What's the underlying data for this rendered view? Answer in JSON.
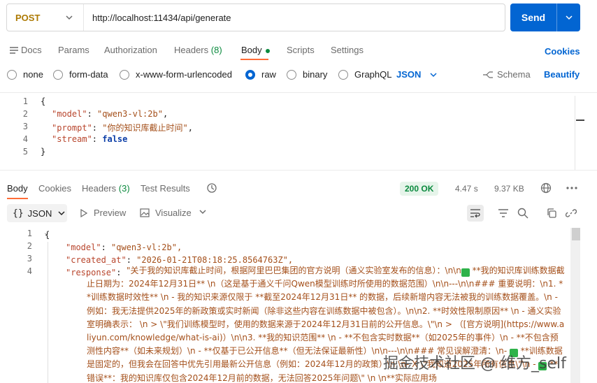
{
  "request": {
    "method": "POST",
    "url": "http://localhost:11434/api/generate",
    "send_label": "Send"
  },
  "request_tabs": {
    "docs": "Docs",
    "params": "Params",
    "authorization": "Authorization",
    "headers": "Headers",
    "headers_count": "(8)",
    "body": "Body",
    "scripts": "Scripts",
    "settings": "Settings",
    "cookies": "Cookies"
  },
  "body_types": {
    "none": "none",
    "form_data": "form-data",
    "urlencoded": "x-www-form-urlencoded",
    "raw": "raw",
    "binary": "binary",
    "graphql": "GraphQL",
    "format": "JSON",
    "schema": "Schema",
    "beautify": "Beautify"
  },
  "request_body": {
    "line_numbers": [
      "1",
      "2",
      "3",
      "4",
      "5"
    ],
    "open_brace": "{",
    "close_brace": "}",
    "model_key": "\"model\"",
    "model_val": "\"qwen3-vl:2b\"",
    "prompt_key": "\"prompt\"",
    "prompt_val": "\"你的知识库截止时间\"",
    "stream_key": "\"stream\"",
    "stream_val": "false"
  },
  "response_tabs": {
    "body": "Body",
    "cookies": "Cookies",
    "headers": "Headers",
    "headers_count": "(3)",
    "test_results": "Test Results",
    "status": "200 OK",
    "time": "4.47 s",
    "size": "9.37 KB"
  },
  "response_toolbar": {
    "format": "JSON",
    "preview": "Preview",
    "visualize": "Visualize"
  },
  "response_body": {
    "line_numbers": [
      "1",
      "2",
      "3",
      "4"
    ],
    "open_brace": "{",
    "model_key": "\"model\"",
    "model_val": "\"qwen3-vl:2b\",",
    "created_key": "\"created_at\"",
    "created_val": "\"2026-01-21T08:18:25.8564763Z\",",
    "response_key": "\"response\"",
    "response_part1": "\"关于我的知识库截止时间，根据阿里巴巴集团的官方说明（通义实验室发布的信息）：\\n\\n",
    "response_part2": " **我的知识库训练数据截止日期为：2024年12月31日**  \\n（这是基于通义千问Qwen模型训练时所使用的数据范围）\\n\\n---\\n\\n### 重要说明：\\n1. **训练数据时效性**  \\n   - 我的知识来源仅限于 **截至2024年12月31日** 的数据，后续新增内容无法被我的训练数据覆盖。\\n   - 例如：我无法提供2025年的新政策或实时新闻（除非这些内容在训练数据中被包含）。\\n\\n2. **时效性限制原因**  \\n   - 通义实验室明确表示：   \\n     > \\\"我们训练模型时，使用的数据来源于2024年12月31日前的公开信息。\\\"\\n     > （[官方说明](https://www.aliyun.com/knowledge/what-is-ai)）\\n\\n3. **我的知识范围**  \\n   - **不包含实时数据**（如2025年的事件）\\n   - **不包含预测性内容**（如未来规划）\\n   - **仅基于已公开信息**（但无法保证最新性）\\n\\n---\\n\\n### 常见误解澄清：\\n- ",
    "response_part3": " **训练数据是固定的，但我会在回答中优先引用最新公开信息（例如：2024年12月的政策）\\n  \\n- X \\\"我知道2025年所有信息\\\"\\n  - ",
    "response_part4": " **错误**：我的知识库仅包含2024年12月前的数据，无法回答2025年问题\\\" \\n  \\n**实际应用场"
  },
  "watermark": "掘金技术社区 @ 维方_self"
}
